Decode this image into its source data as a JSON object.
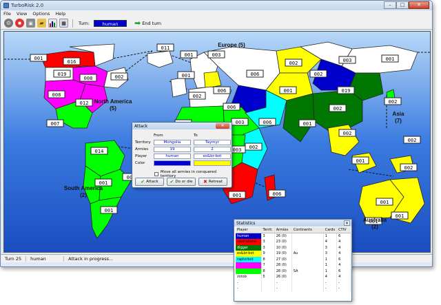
{
  "window": {
    "title": "TurboRisk 2.0",
    "controls": {
      "minimize": "–",
      "maximize": "□",
      "close": "✕"
    }
  },
  "menu": [
    "File",
    "View",
    "Options",
    "Help"
  ],
  "toolbar": {
    "icons": [
      "gear-icon",
      "stop-icon",
      "save-icon",
      "open-icon",
      "chart-icon",
      "calculator-icon"
    ],
    "turn_label": "Turn:",
    "turn_player": "human",
    "end_turn_label": "End turn"
  },
  "map": {
    "continent_labels": [
      {
        "name": "Europe",
        "count": "(5)"
      },
      {
        "name": "North America",
        "count": "(5)"
      },
      {
        "name": "Asia",
        "count": "(7)"
      },
      {
        "name": "South America",
        "count": "(2)"
      },
      {
        "name": "Australia",
        "count": "(2)"
      }
    ],
    "armies": [
      "001",
      "016",
      "019",
      "008",
      "002",
      "008",
      "012",
      "007",
      "011",
      "001",
      "003",
      "006",
      "006",
      "001",
      "002",
      "003",
      "006",
      "002",
      "001",
      "003",
      "001",
      "019",
      "002",
      "002",
      "002",
      "001",
      "002",
      "001",
      "002",
      "001",
      "006",
      "002",
      "014",
      "001",
      "002",
      "001",
      "001",
      "001",
      "001",
      "001",
      "006",
      "003",
      "002"
    ]
  },
  "attack_dialog": {
    "title": "Attack",
    "close_glyph": "✕",
    "from_header": "From",
    "to_header": "To",
    "rows": [
      {
        "label": "Territory",
        "from": "Mongolia",
        "to": "Taymyr"
      },
      {
        "label": "Armies",
        "from": "19",
        "to": "2"
      },
      {
        "label": "Player",
        "from": "human",
        "to": "es&br-bot"
      },
      {
        "label": "Color",
        "from": "",
        "to": ""
      }
    ],
    "checkbox_label": "Move all armies in conquered territory",
    "buttons": {
      "attack": "Attack",
      "do_or_die": "Do or die",
      "retreat": "Retreat"
    }
  },
  "statistics": {
    "title": "Statistics",
    "columns": [
      "Player",
      "Territ.",
      "Armies",
      "Continents",
      "Cards",
      "CTIV"
    ],
    "rows": [
      {
        "player": "human",
        "color": "#0000cc",
        "text": "#ffffff",
        "territ": "3",
        "armies": "26 (0)",
        "continents": "",
        "cards": "1",
        "ctiv": "6"
      },
      {
        "player": "australion+",
        "color": "#ff0000",
        "text": "#000000",
        "territ": "3",
        "armies": "23 (0)",
        "continents": "",
        "cards": "4",
        "ctiv": "4"
      },
      {
        "player": "digger",
        "color": "#007700",
        "text": "#ffffff",
        "territ": "3",
        "armies": "10 (0)",
        "continents": "",
        "cards": "3",
        "ctiv": "4"
      },
      {
        "player": "es&br-bot",
        "color": "#ffff00",
        "text": "#000000",
        "territ": "9",
        "armies": "19 (0)",
        "continents": "Au",
        "cards": "3",
        "ctiv": "4"
      },
      {
        "player": "raptorbot",
        "color": "#00ffff",
        "text": "#000000",
        "territ": "8",
        "armies": "27 (0)",
        "continents": "",
        "cards": "1",
        "ctiv": "6"
      },
      {
        "player": "",
        "color": "#ff00ff",
        "text": "#000000",
        "territ": "7",
        "armies": "28 (0)",
        "continents": "",
        "cards": "1",
        "ctiv": "4"
      },
      {
        "player": "",
        "color": "#00ff00",
        "text": "#000000",
        "territ": "8",
        "armies": "28 (0)",
        "continents": "SA",
        "cards": "1",
        "ctiv": "6"
      },
      {
        "player": "zotob",
        "color": "#ffffff",
        "text": "#000000",
        "territ": "5",
        "armies": "26 (0)",
        "continents": "",
        "cards": "4",
        "ctiv": "4"
      }
    ],
    "empty_rows": [
      [
        "-",
        "",
        "-",
        "",
        "-",
        "-"
      ],
      [
        "-",
        "",
        "-",
        "",
        "-",
        "-"
      ]
    ]
  },
  "status": {
    "turn": "Turn 25",
    "player": "human",
    "message": "Attack in progress..."
  },
  "colors": {
    "human": "#0000cc",
    "australion": "#ff0000",
    "digger": "#007700",
    "esbr": "#ffff00",
    "raptor": "#00ffff",
    "magenta": "#ff00ff",
    "lime": "#00ff00",
    "zotob": "#ffffff",
    "ocean": "#2d6edc"
  }
}
